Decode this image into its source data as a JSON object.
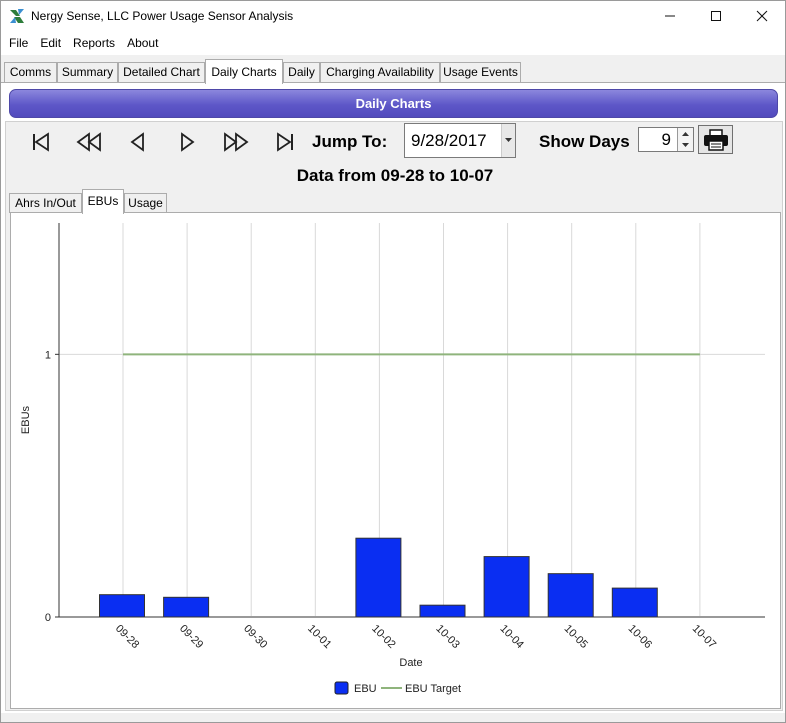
{
  "window": {
    "title": "Nergy Sense, LLC Power Usage Sensor Analysis",
    "minimize": "—",
    "maximize": "☐",
    "close": "✕"
  },
  "menu": [
    "File",
    "Edit",
    "Reports",
    "About"
  ],
  "tabs": [
    {
      "label": "Comms",
      "active": false
    },
    {
      "label": "Summary",
      "active": false
    },
    {
      "label": "Detailed Chart",
      "active": false
    },
    {
      "label": "Daily Charts",
      "active": true
    },
    {
      "label": "Daily",
      "active": false
    },
    {
      "label": "Charging Availability",
      "active": false
    },
    {
      "label": "Usage Events",
      "active": false
    }
  ],
  "header": {
    "title": "Daily Charts"
  },
  "toolbar": {
    "jump_label": "Jump To:",
    "date_value": "9/28/2017",
    "show_days_label": "Show Days",
    "days_value": "9",
    "nav_icons": [
      "skip-to-first-icon",
      "rewind-icon",
      "previous-icon",
      "next-icon",
      "fast-forward-icon",
      "skip-to-last-icon"
    ],
    "print_icon": "printer-icon"
  },
  "range_title": "Data from 09-28 to 10-07",
  "subtabs": [
    {
      "label": "Ahrs In/Out",
      "active": false
    },
    {
      "label": "EBUs",
      "active": true
    },
    {
      "label": "Usage",
      "active": false
    }
  ],
  "chart_data": {
    "type": "bar",
    "categories": [
      "09-28",
      "09-29",
      "09-30",
      "10-01",
      "10-02",
      "10-03",
      "10-04",
      "10-05",
      "10-06",
      "10-07"
    ],
    "series": [
      {
        "name": "EBU",
        "type": "bar",
        "values": [
          0.085,
          0.075,
          0.0,
          0.0,
          0.3,
          0.045,
          0.23,
          0.165,
          0.11,
          0.0
        ],
        "color": "#0a2ef2"
      },
      {
        "name": "EBU Target",
        "type": "line",
        "values": [
          1,
          1,
          1,
          1,
          1,
          1,
          1,
          1,
          1,
          1
        ],
        "color": "#8fb47c"
      }
    ],
    "xlabel": "Date",
    "ylabel": "EBUs",
    "yticks": [
      0,
      1
    ],
    "ylim": [
      0,
      1.5
    ],
    "grid": true,
    "legend": "bottom-center"
  }
}
